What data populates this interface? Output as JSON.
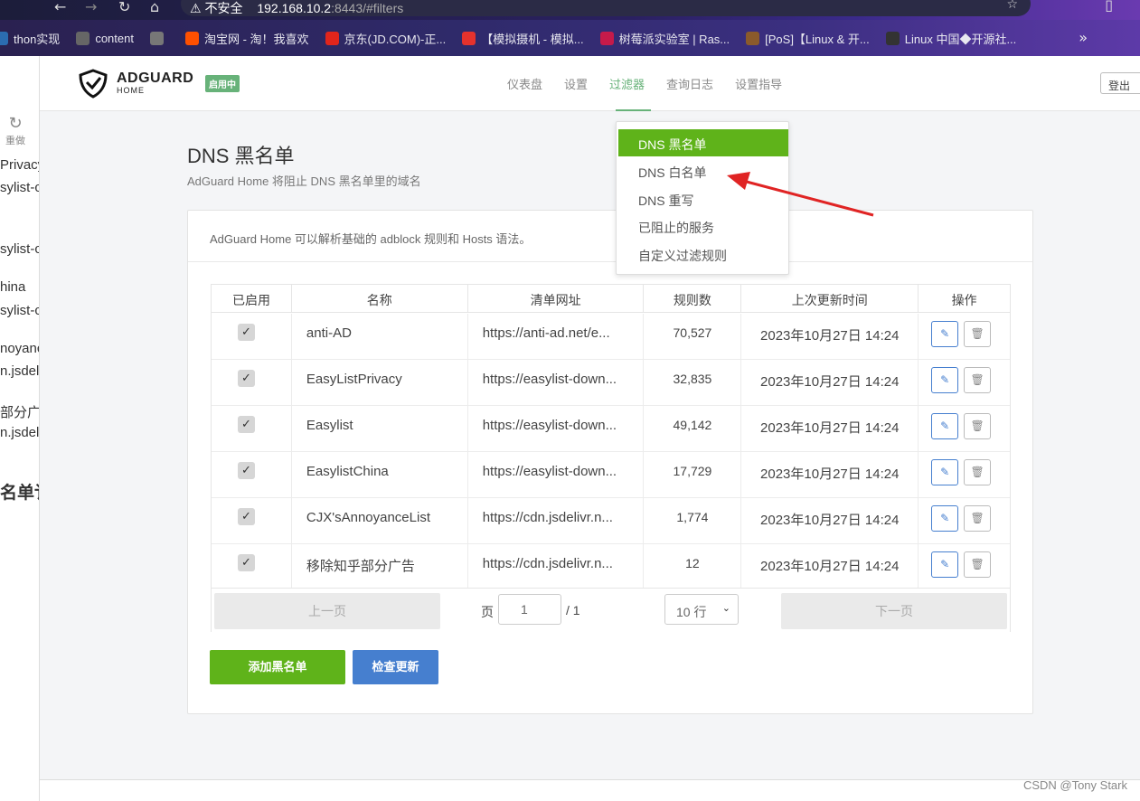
{
  "browser": {
    "security_warning": "不安全",
    "url_host": "192.168.10.2",
    "url_path": ":8443/#filters",
    "bookmarks": [
      {
        "label": "thon实现",
        "color": "#2b6cb0"
      },
      {
        "label": "content",
        "color": "#666"
      },
      {
        "label": "",
        "color": "#777"
      },
      {
        "label": "淘宝网 - 淘！我喜欢",
        "color": "#ff5000"
      },
      {
        "label": "京东(JD.COM)-正...",
        "color": "#e1251b"
      },
      {
        "label": "【模拟摄机 - 模拟...",
        "color": "#e5322d"
      },
      {
        "label": "树莓派实验室 | Ras...",
        "color": "#c51a4a"
      },
      {
        "label": "[PoS]【Linux & 开...",
        "color": "#8b5a2b"
      },
      {
        "label": "Linux 中国◆开源社...",
        "color": "#333"
      }
    ]
  },
  "left_panel": {
    "redo": "重做",
    "lines": [
      "Privacy",
      "sylist-c",
      "sylist-c",
      "hina",
      "sylist-c",
      "noyanc",
      "n.jsdel",
      "部分广",
      "n.jsdel",
      "名单讠"
    ]
  },
  "header": {
    "brand": "ADGUARD",
    "brand_sub": "HOME",
    "status": "启用中",
    "nav": [
      "仪表盘",
      "设置",
      "过滤器",
      "查询日志",
      "设置指导"
    ],
    "active_nav": "过滤器",
    "logout": "登出"
  },
  "page": {
    "title": "DNS 黑名单",
    "subtitle": "AdGuard Home 将阻止 DNS 黑名单里的域名",
    "card_note": "AdGuard Home 可以解析基础的 adblock 规则和 Hosts 语法。"
  },
  "table": {
    "headers": [
      "已启用",
      "名称",
      "清单网址",
      "规则数",
      "上次更新时间",
      "操作"
    ],
    "rows": [
      {
        "enabled": "✓",
        "name": "anti-AD",
        "url": "https://anti-ad.net/e...",
        "rules": "70,527",
        "updated": "2023年10月27日 14:24"
      },
      {
        "enabled": "✓",
        "name": "EasyListPrivacy",
        "url": "https://easylist-down...",
        "rules": "32,835",
        "updated": "2023年10月27日 14:24"
      },
      {
        "enabled": "✓",
        "name": "Easylist",
        "url": "https://easylist-down...",
        "rules": "49,142",
        "updated": "2023年10月27日 14:24"
      },
      {
        "enabled": "✓",
        "name": "EasylistChina",
        "url": "https://easylist-down...",
        "rules": "17,729",
        "updated": "2023年10月27日 14:24"
      },
      {
        "enabled": "✓",
        "name": "CJX'sAnnoyanceList",
        "url": "https://cdn.jsdelivr.n...",
        "rules": "1,774",
        "updated": "2023年10月27日 14:24"
      },
      {
        "enabled": "✓",
        "name": "移除知乎部分广告",
        "url": "https://cdn.jsdelivr.n...",
        "rules": "12",
        "updated": "2023年10月27日 14:24"
      }
    ]
  },
  "pager": {
    "prev": "上一页",
    "page_label": "页",
    "page_value": "1",
    "total": "/ 1",
    "rows_per_page": "10 行",
    "next": "下一页"
  },
  "actions": {
    "add": "添加黑名单",
    "check": "检查更新"
  },
  "dropdown": {
    "items": [
      "DNS 黑名单",
      "DNS 白名单",
      "DNS 重写",
      "已阻止的服务",
      "自定义过滤规则"
    ],
    "selected": "DNS 黑名单"
  },
  "watermark": "CSDN @Tony Stark",
  "colors": {
    "accent_green": "#5fb31a",
    "accent_blue": "#467fcf",
    "annotation_arrow": "#e02424"
  }
}
